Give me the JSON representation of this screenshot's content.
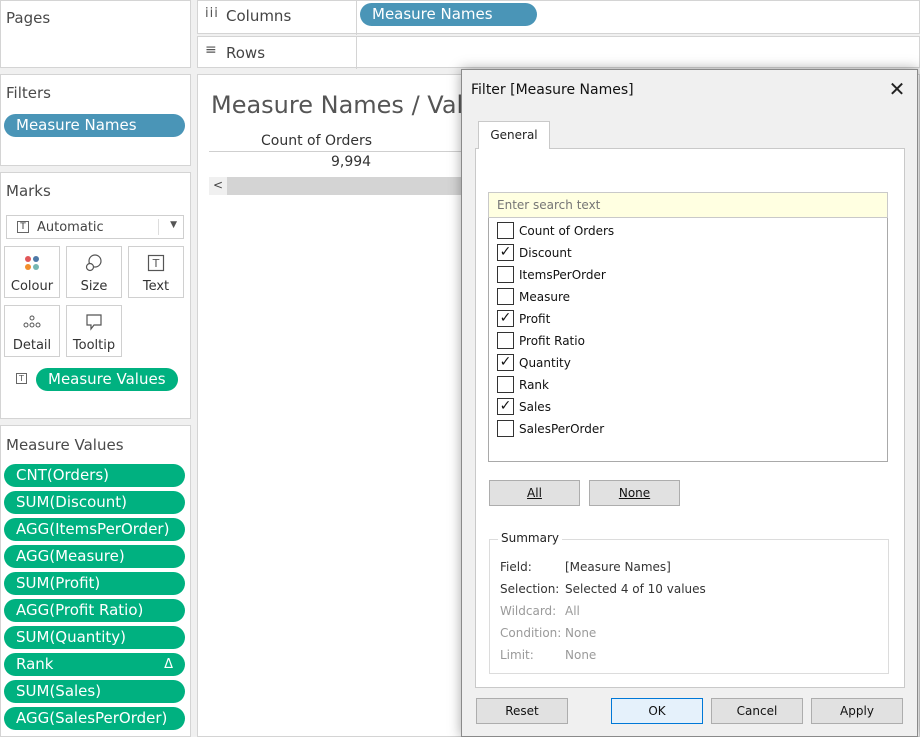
{
  "pages": {
    "title": "Pages"
  },
  "columns": {
    "label": "Columns",
    "pill": "Measure Names"
  },
  "rows": {
    "label": "Rows"
  },
  "filters": {
    "title": "Filters",
    "pill": "Measure Names"
  },
  "marks": {
    "title": "Marks",
    "type_value": "Automatic",
    "buttons": {
      "colour": "Colour",
      "size": "Size",
      "text": "Text",
      "detail": "Detail",
      "tooltip": "Tooltip"
    },
    "text_pill": "Measure Values"
  },
  "measure_values": {
    "title": "Measure Values",
    "items": [
      "CNT(Orders)",
      "SUM(Discount)",
      "AGG(ItemsPerOrder)",
      "AGG(Measure)",
      "SUM(Profit)",
      "AGG(Profit Ratio)",
      "SUM(Quantity)",
      "Rank",
      "SUM(Sales)",
      "AGG(SalesPerOrder)"
    ],
    "rank_badge": "Δ"
  },
  "view": {
    "title": "Measure Names / Values",
    "column_header": "Count of Orders",
    "value": "9,994",
    "scroll_left": "<"
  },
  "dialog": {
    "title": "Filter [Measure Names]",
    "close": "✕",
    "tab": "General",
    "search_placeholder": "Enter search text",
    "items": [
      {
        "label": "Count of Orders",
        "check": ""
      },
      {
        "label": "Discount",
        "check": "✓"
      },
      {
        "label": "ItemsPerOrder",
        "check": ""
      },
      {
        "label": "Measure",
        "check": ""
      },
      {
        "label": "Profit",
        "check": "✓"
      },
      {
        "label": "Profit Ratio",
        "check": ""
      },
      {
        "label": "Quantity",
        "check": "✓"
      },
      {
        "label": "Rank",
        "check": ""
      },
      {
        "label": "Sales",
        "check": "✓"
      },
      {
        "label": "SalesPerOrder",
        "check": ""
      }
    ],
    "all_button": "All",
    "none_button": "None",
    "summary": {
      "title": "Summary",
      "field_label": "Field:",
      "field_value": "[Measure Names]",
      "selection_label": "Selection:",
      "selection_value": "Selected 4 of 10 values",
      "wildcard_label": "Wildcard:",
      "wildcard_value": "All",
      "condition_label": "Condition:",
      "condition_value": "None",
      "limit_label": "Limit:",
      "limit_value": "None"
    },
    "reset_button": "Reset",
    "ok_button": "OK",
    "cancel_button": "Cancel",
    "apply_button": "Apply"
  },
  "colors": {
    "blue_pill": "#4a95b7",
    "green_pill": "#00b180",
    "search_bg": "#ffffe1"
  }
}
